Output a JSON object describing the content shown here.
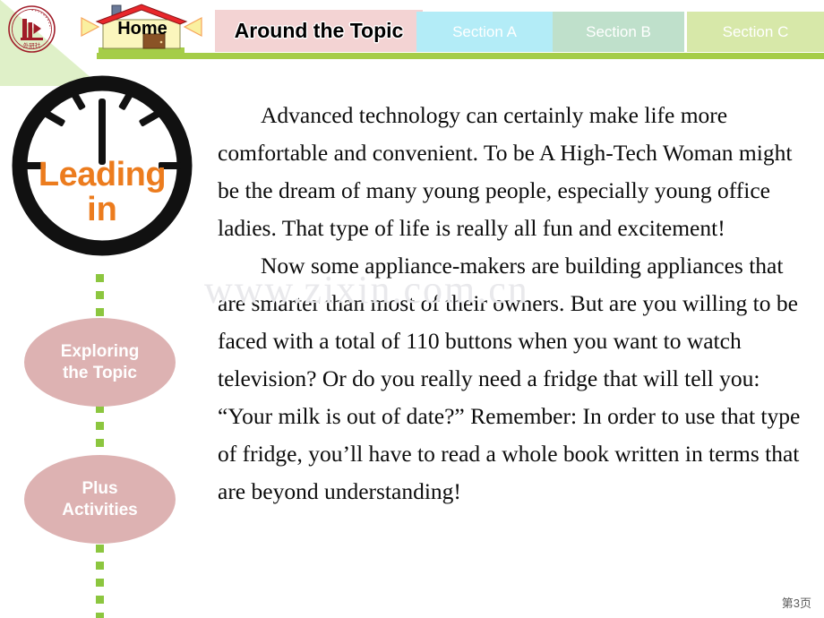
{
  "slide": {
    "page_label": "第3页",
    "watermark": "www.zixin.com.cn"
  },
  "header": {
    "logo_name": "fltrp-publisher-logo",
    "logo_text": "外研社",
    "home_label": "Home",
    "prev_arrow": "left-triangle-arrow",
    "next_arrow": "right-triangle-arrow",
    "title": "Around the Topic",
    "tabs": [
      {
        "label": "Section A",
        "color": "#b3ecf7"
      },
      {
        "label": "Section B",
        "color": "#bfe0cb"
      },
      {
        "label": "Section C",
        "color": "#d7e8a9"
      }
    ],
    "rule_color": "#a5cd48"
  },
  "sidebar": {
    "clock": {
      "icon": "clock-icon",
      "line1": "Leading",
      "line2": "in",
      "text_color": "#ec7c1e"
    },
    "items": [
      {
        "label_line1": "Exploring",
        "label_line2": "the Topic",
        "color": "#ddb2b2"
      },
      {
        "label_line1": "Plus",
        "label_line2": "Activities",
        "color": "#ddb2b2"
      }
    ],
    "connector_color": "#8cc63f"
  },
  "content": {
    "paragraphs": [
      "Advanced technology can certainly make life more comfortable and convenient. To be A High-Tech Woman might be the dream of many young people, especially young office ladies. That type of life is really all fun and excitement!",
      "Now some appliance-makers are building appliances that are smarter than most of their owners. But are you willing to be faced with a total of 110 buttons when you want to watch television? Or do you really need a fridge that will tell you: “Your milk is out of date?” Remember: In order to use that type of fridge, you’ll have to read a whole book written in terms that are beyond understanding!"
    ]
  }
}
